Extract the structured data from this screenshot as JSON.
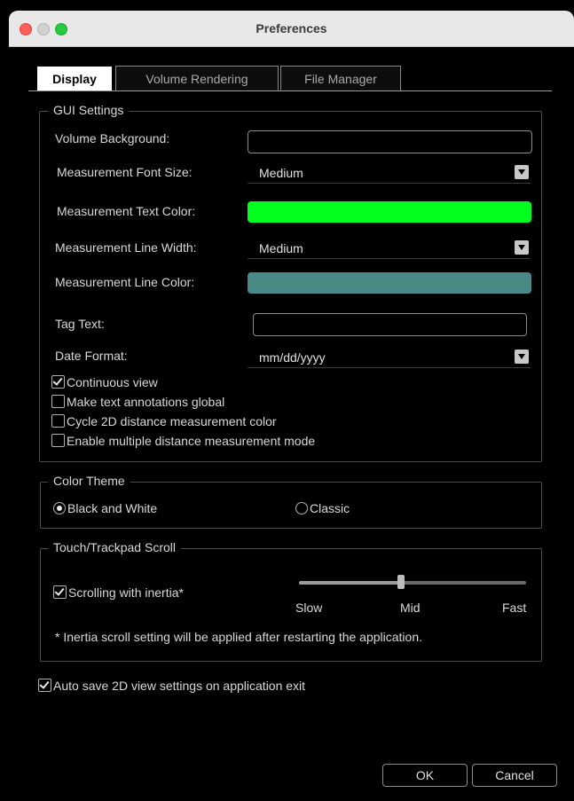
{
  "window": {
    "title": "Preferences"
  },
  "tabs": [
    {
      "label": "Display",
      "active": true
    },
    {
      "label": "Volume Rendering",
      "active": false
    },
    {
      "label": "File Manager",
      "active": false
    }
  ],
  "gui_settings": {
    "legend": "GUI Settings",
    "volume_background_label": "Volume Background:",
    "volume_background_value": "",
    "font_size_label": "Measurement Font Size:",
    "font_size_value": "Medium",
    "text_color_label": "Measurement Text Color:",
    "text_color_value": "#00ff1e",
    "line_width_label": "Measurement Line Width:",
    "line_width_value": "Medium",
    "line_color_label": "Measurement Line Color:",
    "line_color_value": "#4a8a86",
    "tag_text_label": "Tag Text:",
    "tag_text_value": "",
    "date_format_label": "Date Format:",
    "date_format_value": "mm/dd/yyyy",
    "checkboxes": [
      {
        "label": "Continuous view",
        "checked": true
      },
      {
        "label": "Make text annotations global",
        "checked": false
      },
      {
        "label": "Cycle 2D distance measurement color",
        "checked": false
      },
      {
        "label": "Enable multiple distance measurement mode",
        "checked": false
      }
    ]
  },
  "color_theme": {
    "legend": "Color Theme",
    "options": [
      {
        "label": "Black and White",
        "selected": true
      },
      {
        "label": "Classic",
        "selected": false
      }
    ]
  },
  "scroll": {
    "legend": "Touch/Trackpad Scroll",
    "inertia_label": "Scrolling with inertia*",
    "inertia_checked": true,
    "slider_value_fraction": 0.45,
    "slider_labels": {
      "slow": "Slow",
      "mid": "Mid",
      "fast": "Fast"
    },
    "note": "* Inertia scroll setting will be applied after restarting the application."
  },
  "auto_save": {
    "label": "Auto save 2D view settings on application exit",
    "checked": true
  },
  "buttons": {
    "ok": "OK",
    "cancel": "Cancel"
  },
  "colors": {
    "text_color_swatch": "#00ff1e",
    "line_color_swatch": "#4a8a86"
  }
}
